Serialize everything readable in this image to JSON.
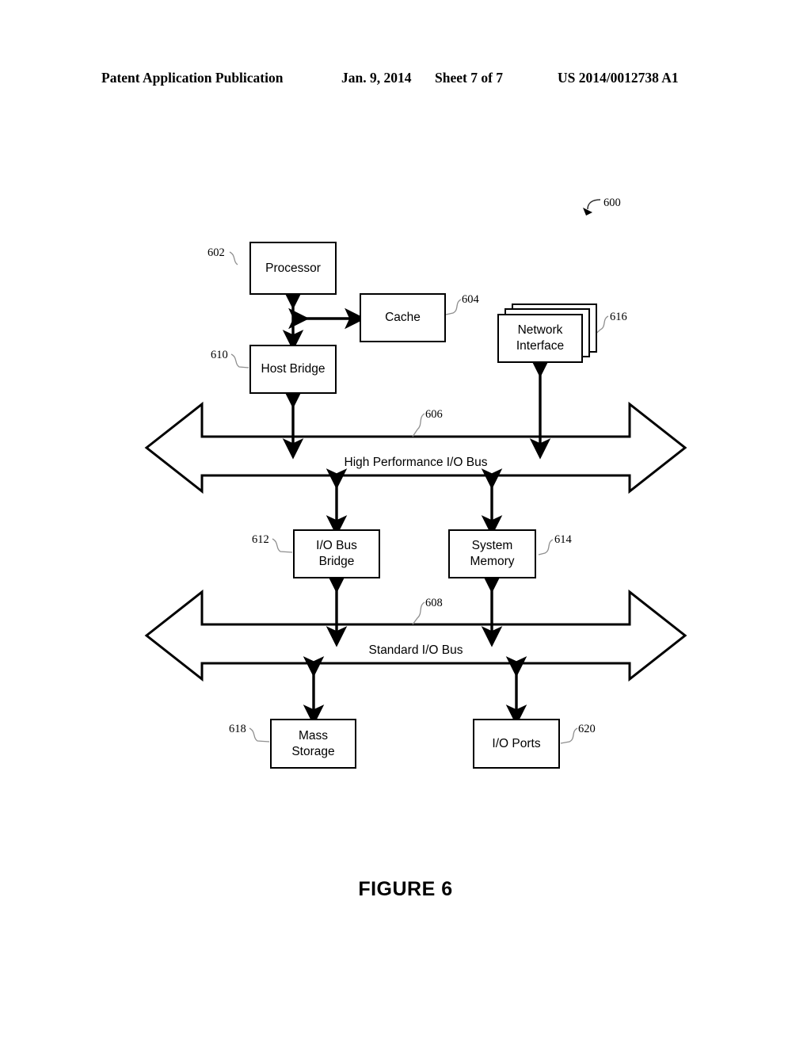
{
  "header": {
    "publication": "Patent Application Publication",
    "date": "Jan. 9, 2014",
    "sheet": "Sheet 7 of 7",
    "patent_number": "US 2014/0012738 A1"
  },
  "figure": {
    "caption": "FIGURE 6",
    "system_ref": "600"
  },
  "blocks": [
    {
      "id": "processor",
      "label": "Processor",
      "ref": "602"
    },
    {
      "id": "cache",
      "label": "Cache",
      "ref": "604"
    },
    {
      "id": "host_bridge",
      "label": "Host Bridge",
      "ref": "610"
    },
    {
      "id": "network_interface",
      "label_line1": "Network",
      "label_line2": "Interface",
      "ref": "616"
    },
    {
      "id": "io_bus_bridge",
      "label_line1": "I/O Bus",
      "label_line2": "Bridge",
      "ref": "612"
    },
    {
      "id": "system_memory",
      "label_line1": "System",
      "label_line2": "Memory",
      "ref": "614"
    },
    {
      "id": "mass_storage",
      "label_line1": "Mass",
      "label_line2": "Storage",
      "ref": "618"
    },
    {
      "id": "io_ports",
      "label": "I/O Ports",
      "ref": "620"
    }
  ],
  "buses": [
    {
      "id": "high_performance_io_bus",
      "label": "High Performance I/O Bus",
      "ref": "606"
    },
    {
      "id": "standard_io_bus",
      "label": "Standard I/O Bus",
      "ref": "608"
    }
  ],
  "colors": {
    "stroke": "#000000",
    "background": "#ffffff",
    "leader": "#8f8f8f"
  }
}
